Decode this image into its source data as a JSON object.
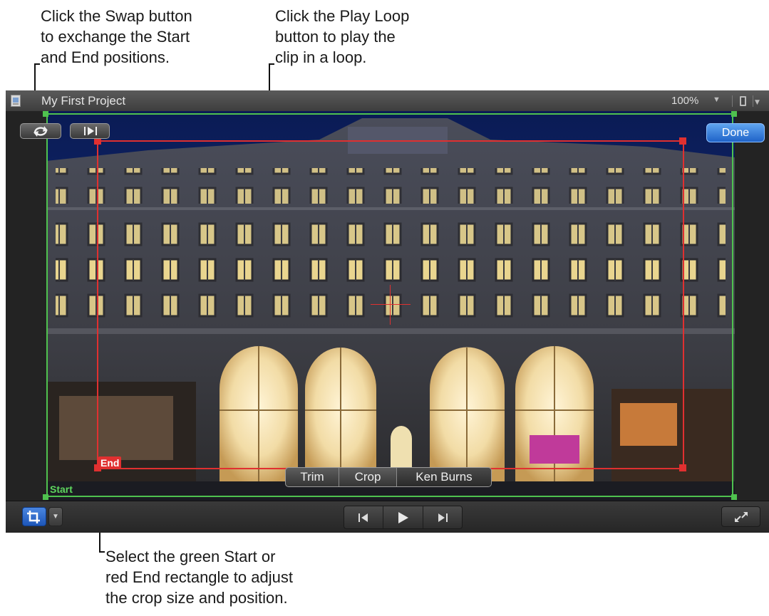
{
  "callouts": {
    "swap": "Click the Swap button\nto exchange the Start\nand End positions.",
    "loop": "Click the Play Loop\nbutton to play the\nclip in a loop.",
    "rect": "Select the green Start or\nred End rectangle to adjust\nthe crop size and position."
  },
  "window": {
    "title": "My First Project",
    "zoom": "100%"
  },
  "viewer": {
    "done_label": "Done",
    "start_label": "Start",
    "end_label": "End",
    "modes": [
      "Trim",
      "Crop",
      "Ken Burns"
    ],
    "selected_mode": "Ken Burns"
  },
  "colors": {
    "start_rect": "#4fc24f",
    "end_rect": "#e03030",
    "accent": "#2a6fd6"
  },
  "icons": {
    "swap": "swap-arrows-icon",
    "play_loop": "play-loop-icon",
    "crop": "crop-icon",
    "previous": "skip-back-icon",
    "play": "play-icon",
    "next": "skip-forward-icon",
    "fullscreen": "fullscreen-icon"
  }
}
